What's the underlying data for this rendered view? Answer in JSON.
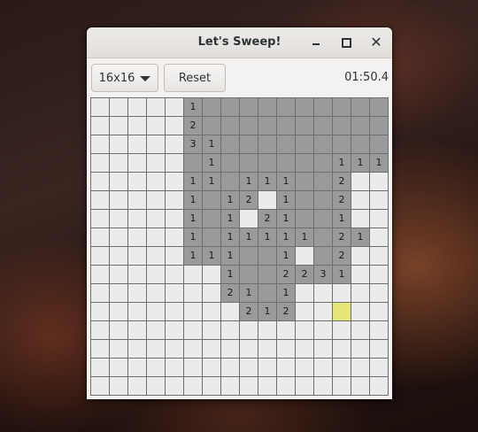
{
  "window": {
    "title": "Let's Sweep!",
    "controls": {
      "minimize_icon": "minimize-icon",
      "maximize_icon": "maximize-icon",
      "close_icon": "close-icon",
      "close_glyph": "✕"
    }
  },
  "toolbar": {
    "size_label": "16x16",
    "size_icon": "chevron-down-icon",
    "reset_label": "Reset",
    "timer": "01:50.4"
  },
  "board": {
    "rows": 16,
    "cols": 16,
    "legend": {
      ".": "covered",
      "o": "revealed-empty",
      "y": "highlighted-covered",
      "1-9": "revealed-number"
    },
    "grid": [
      ".....1oooooooooo",
      ".....2oooooooooo",
      ".....31ooooooooo",
      ".....o1oooooo111",
      ".....11o111oo2..",
      ".....1o12.1oo2..",
      ".....1o1.21oo1..",
      ".....1o11111o21.",
      ".....111oo1.o2..",
      ".......1oo2231..",
      ".......21o1.....",
      "........212..y..",
      "................",
      "................",
      "................",
      "................"
    ]
  },
  "colors": {
    "covered": "#ebebeb",
    "revealed": "#9a9a9a",
    "highlight": "#e6e67a",
    "grid": "#6f6f6f"
  }
}
